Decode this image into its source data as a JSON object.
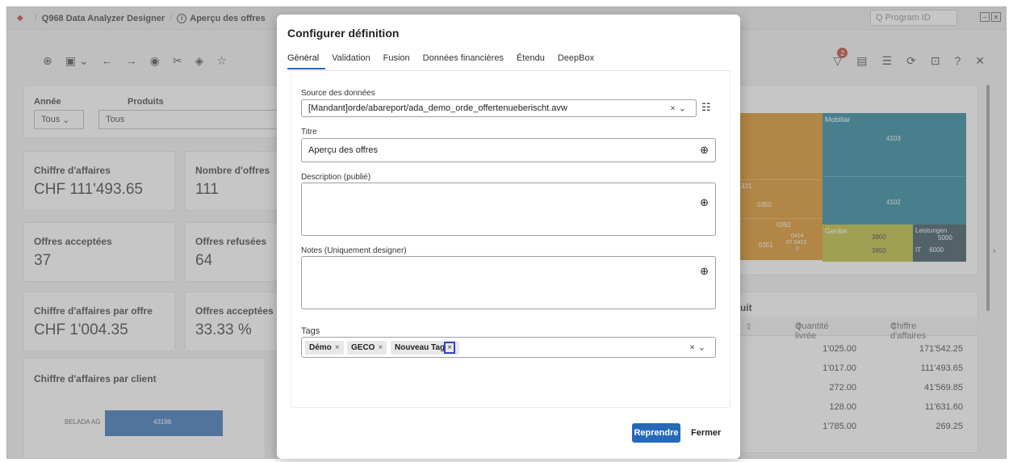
{
  "topbar": {
    "breadcrumb_1": "Q968 Data Analyzer Designer",
    "breadcrumb_2": "Aperçu des offres",
    "search_placeholder": "Q Program ID"
  },
  "toolbar": {
    "filter_badge": "2"
  },
  "filters": {
    "year_label": "Année",
    "year_value": "Tous",
    "products_label": "Produits",
    "products_value": "Tous"
  },
  "kpis": [
    {
      "title": "Chiffre d'affaires",
      "value": "CHF 111'493.65"
    },
    {
      "title": "Nombre d'offres",
      "value": "111"
    },
    {
      "title": "Offres acceptées",
      "value": "37"
    },
    {
      "title": "Offres refusées",
      "value": "64"
    },
    {
      "title": "Chiffre d'affaires par offre",
      "value": "CHF 1'004.35"
    },
    {
      "title": "Offres acceptées",
      "value": "33.33 %"
    }
  ],
  "client_chart": {
    "title": "Chiffre d'affaires par client",
    "bar_label": "BELADA AG",
    "bar_value": "43196"
  },
  "treemap": {
    "mobiliar": "Mobiliar",
    "n4103": "4103",
    "n4102": "4102",
    "n321": "321",
    "n0350": "0350",
    "n0392": "0392",
    "n0414": "0414",
    "n0351": "0351",
    "n07": "07",
    "n0410": "0410",
    "n0": "0",
    "gerate": "Geräte",
    "n3800": "3800",
    "n3850": "3850",
    "leistungen": "Leistungen",
    "n5000": "5000",
    "it": "IT",
    "n6000": "6000"
  },
  "product_table": {
    "title_frag": "uit",
    "col_qty": "Quantité livrée",
    "col_ca": "Chiffre d'affaires",
    "rows": [
      {
        "qty": "1'025.00",
        "ca": "171'542.25"
      },
      {
        "qty": "1'017.00",
        "ca": "111'493.65"
      },
      {
        "qty": "272.00",
        "ca": "41'569.85"
      },
      {
        "qty": "128.00",
        "ca": "11'631.60"
      },
      {
        "qty": "1'785.00",
        "ca": "269.25"
      }
    ]
  },
  "modal": {
    "title": "Configurer définition",
    "tabs": [
      "Général",
      "Validation",
      "Fusion",
      "Données financières",
      "Étendu",
      "DeepBox"
    ],
    "source_label": "Source des données",
    "source_value": "[Mandant]orde/abareport/ada_demo_orde_offertenueberischt.avw",
    "title_label": "Titre",
    "title_value": "Aperçu des offres",
    "desc_label": "Description (publié)",
    "notes_label": "Notes (Uniquement designer)",
    "tags_label": "Tags",
    "tags": [
      "Démo",
      "GECO",
      "Nouveau Tag"
    ],
    "btn_apply": "Reprendre",
    "btn_close": "Fermer"
  }
}
